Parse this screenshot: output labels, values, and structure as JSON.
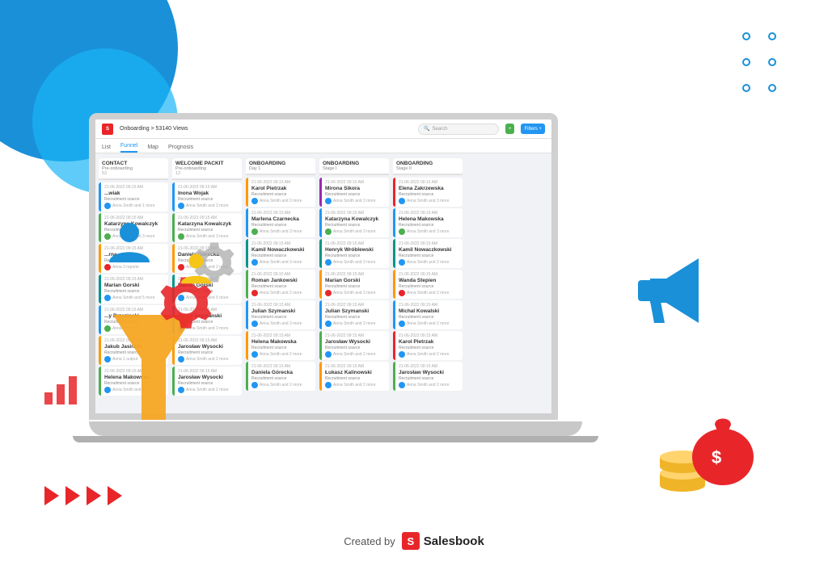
{
  "background": {
    "color": "#ffffff"
  },
  "dots": {
    "count": 6,
    "color": "#1a90d9"
  },
  "play_arrows": {
    "count": 4,
    "color": "#e8262a"
  },
  "crm": {
    "header": {
      "logo": "S",
      "breadcrumb": "Onboarding > 53140 Views",
      "search_placeholder": "Search",
      "btn_green": "+",
      "btn_blue": "Filters +"
    },
    "tabs": [
      {
        "label": "List",
        "active": false
      },
      {
        "label": "Funnel",
        "active": true
      },
      {
        "label": "Map",
        "active": false
      },
      {
        "label": "Prognosis",
        "active": false
      }
    ],
    "columns": [
      {
        "title": "CONTACT",
        "subtitle": "Pre-onboarding",
        "count": "53",
        "color": "green",
        "cards": [
          {
            "date": "21-06-2022 09:15 AM",
            "name": "...wiak",
            "label": "Recruitment source",
            "assignee": "Anna Smith and 1 more"
          },
          {
            "date": "21-06-2022 09:15 AM",
            "name": "Katarzyna Kowalczyk",
            "label": "Recruitment source",
            "assignee": "Anna Smith and 3 more"
          },
          {
            "date": "21-06-2022 09:15 AM",
            "name": "...rna",
            "label": "Recruitment source",
            "assignee": "Anna 3 reports"
          },
          {
            "date": "21-06-2022 09:15 AM",
            "name": "Marian Gorski",
            "label": "Recruitment source",
            "assignee": "Anna Smith and 5 more"
          },
          {
            "date": "21-06-2022 09:15 AM",
            "name": "...y Brzezinski",
            "label": "Recruitment source",
            "assignee": "Anna 2 reports"
          },
          {
            "date": "21-06-2022 09:15 AM",
            "name": "Jakub Jasinski",
            "label": "Recruitment source",
            "assignee": "Anna 1 output"
          },
          {
            "date": "21-06-2022 09:15 AM",
            "name": "Helena Makowska",
            "label": "Recruitment source",
            "assignee": "Anna Smith and 1 more"
          }
        ]
      },
      {
        "title": "WELCOME PACKIT",
        "subtitle": "Pre-onboarding",
        "count": "12",
        "color": "blue",
        "cards": [
          {
            "date": "21-06-2022 09:15 AM",
            "name": "Inona Wojak",
            "label": "Recruitment source",
            "assignee": "Anna Smith and 3 more"
          },
          {
            "date": "21-06-2022 09:15 AM",
            "name": "Katarzyna Kowalczyk",
            "label": "Recruitment source",
            "assignee": "Anna Smith and 3 more"
          },
          {
            "date": "21-06-2022 09:15 AM",
            "name": "Daniela Górecka",
            "label": "Recruitment source",
            "assignee": "Anna Smith and 2 more"
          },
          {
            "date": "21-06-2022 09:15 AM",
            "name": "Marian Gorski",
            "label": "Recruitment source",
            "assignee": "Anna Smith and 5 more"
          },
          {
            "date": "21-06-2022 09:15 AM",
            "name": "Julian Szymanski",
            "label": "Recruitment source",
            "assignee": "Anna Smith and 3 more"
          },
          {
            "date": "21-06-2022 09:15 AM",
            "name": "Jarosław Wysocki",
            "label": "Recruitment source",
            "assignee": "Anna Smith and 2 more"
          },
          {
            "date": "21-06-2022 09:15 AM",
            "name": "Jarosław Wysocki",
            "label": "Recruitment source",
            "assignee": "Anna Smith and 2 more"
          }
        ]
      },
      {
        "title": "ONBOARDING",
        "subtitle": "Day 1",
        "count": "",
        "color": "orange",
        "cards": [
          {
            "date": "21-06-2022 09:15 AM",
            "name": "Karol Pietrzak",
            "label": "Recruitment source",
            "assignee": "Anna Smith and 3 more"
          },
          {
            "date": "21-06-2022 09:15 AM",
            "name": "Marlena Czarnecka",
            "label": "Recruitment source",
            "assignee": "Anna Smith and 3 more"
          },
          {
            "date": "21-06-2022 09:15 AM",
            "name": "Kamil Nowaczkowski",
            "label": "Recruitment source",
            "assignee": "Anna Smith and 3 more"
          },
          {
            "date": "21-06-2022 09:15 AM",
            "name": "Roman Jankowski",
            "label": "Recruitment source",
            "assignee": "Anna Smith and 2 more"
          },
          {
            "date": "21-06-2022 09:15 AM",
            "name": "Julian Szymanski",
            "label": "Recruitment source",
            "assignee": "Anna Smith and 3 more"
          },
          {
            "date": "21-06-2022 09:15 AM",
            "name": "Helena Makowska",
            "label": "Recruitment source",
            "assignee": "Anna Smith and 2 more"
          },
          {
            "date": "21-06-2022 09:15 AM",
            "name": "Daniela Górecka",
            "label": "Recruitment source",
            "assignee": "Anna Smith and 2 more"
          }
        ]
      },
      {
        "title": "ONBOARDING",
        "subtitle": "Stage I",
        "count": "",
        "color": "purple",
        "cards": [
          {
            "date": "21-06-2022 09:15 AM",
            "name": "Mirona Sikora",
            "label": "Recruitment source",
            "assignee": "Anna Smith and 3 more"
          },
          {
            "date": "21-06-2022 09:15 AM",
            "name": "Katarzyna Kowalczyk",
            "label": "Recruitment source",
            "assignee": "Anna Smith and 3 more"
          },
          {
            "date": "21-06-2022 09:15 AM",
            "name": "Henryk Wróblewski",
            "label": "Recruitment source",
            "assignee": "Anna Smith and 3 more"
          },
          {
            "date": "21-06-2022 09:15 AM",
            "name": "Marian Gorski",
            "label": "Recruitment source",
            "assignee": "Anna Smith and 3 more"
          },
          {
            "date": "21-06-2022 09:15 AM",
            "name": "Julian Szymanski",
            "label": "Recruitment source",
            "assignee": "Anna Smith and 3 more"
          },
          {
            "date": "21-06-2022 09:15 AM",
            "name": "Jarosław Wysocki",
            "label": "Recruitment source",
            "assignee": "Anna Smith and 2 more"
          },
          {
            "date": "21-06-2022 09:15 AM",
            "name": "Łukasz Kalinowski",
            "label": "Recruitment source",
            "assignee": "Anna Smith and 2 more"
          }
        ]
      },
      {
        "title": "ONBOARDING",
        "subtitle": "Stage II",
        "count": "",
        "color": "red",
        "cards": [
          {
            "date": "21-06-2022 09:15 AM",
            "name": "Elena Zakrzewska",
            "label": "Recruitment source",
            "assignee": "Anna Smith and 3 more"
          },
          {
            "date": "21-06-2022 09:15 AM",
            "name": "Helena Makowska",
            "label": "Recruitment source",
            "assignee": "Anna Smith and 3 more"
          },
          {
            "date": "21-06-2022 09:15 AM",
            "name": "Kamil Nowaczkowski",
            "label": "Recruitment source",
            "assignee": "Anna Smith and 2 more"
          },
          {
            "date": "21-06-2022 09:15 AM",
            "name": "Wanda Stepien",
            "label": "Recruitment source",
            "assignee": "Anna Smith and 2 more"
          },
          {
            "date": "21-06-2022 09:15 AM",
            "name": "Michal Kowalski",
            "label": "Recruitment source",
            "assignee": "Anna Smith and 2 more"
          },
          {
            "date": "21-06-2022 09:15 AM",
            "name": "Karol Pietrzak",
            "label": "Recruitment source",
            "assignee": "Anna Smith and 2 more"
          },
          {
            "date": "21-06-2022 09:15 AM",
            "name": "Jarosław Wysocki",
            "label": "Recruitment source",
            "assignee": "Anna Smith and 2 more"
          }
        ]
      }
    ]
  },
  "footer": {
    "created_by": "Created by",
    "brand": "Salesbook",
    "logo_letter": "S"
  }
}
